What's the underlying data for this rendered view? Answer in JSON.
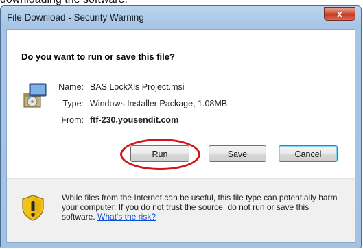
{
  "caption": "downloading the software.",
  "window": {
    "title": "File Download - Security Warning",
    "close_symbol": "x"
  },
  "dialog": {
    "question": "Do you want to run or save this file?",
    "name_label": "Name:",
    "name_value": "BAS LockXls Project.msi",
    "type_label": "Type:",
    "type_value": "Windows Installer Package, 1.08MB",
    "from_label": "From:",
    "from_value": "ftf-230.yousendit.com"
  },
  "buttons": {
    "run": "Run",
    "save": "Save",
    "cancel": "Cancel"
  },
  "warning": {
    "text": "While files from the Internet can be useful, this file type can potentially harm your computer. If you do not trust the source, do not run or save this software.",
    "link": "What's the risk?"
  },
  "icons": {
    "package": "windows-installer-package-icon",
    "shield": "security-shield-icon"
  },
  "colors": {
    "highlight": "#d4141a",
    "link": "#0b4fd6",
    "close": "#c43a22"
  }
}
